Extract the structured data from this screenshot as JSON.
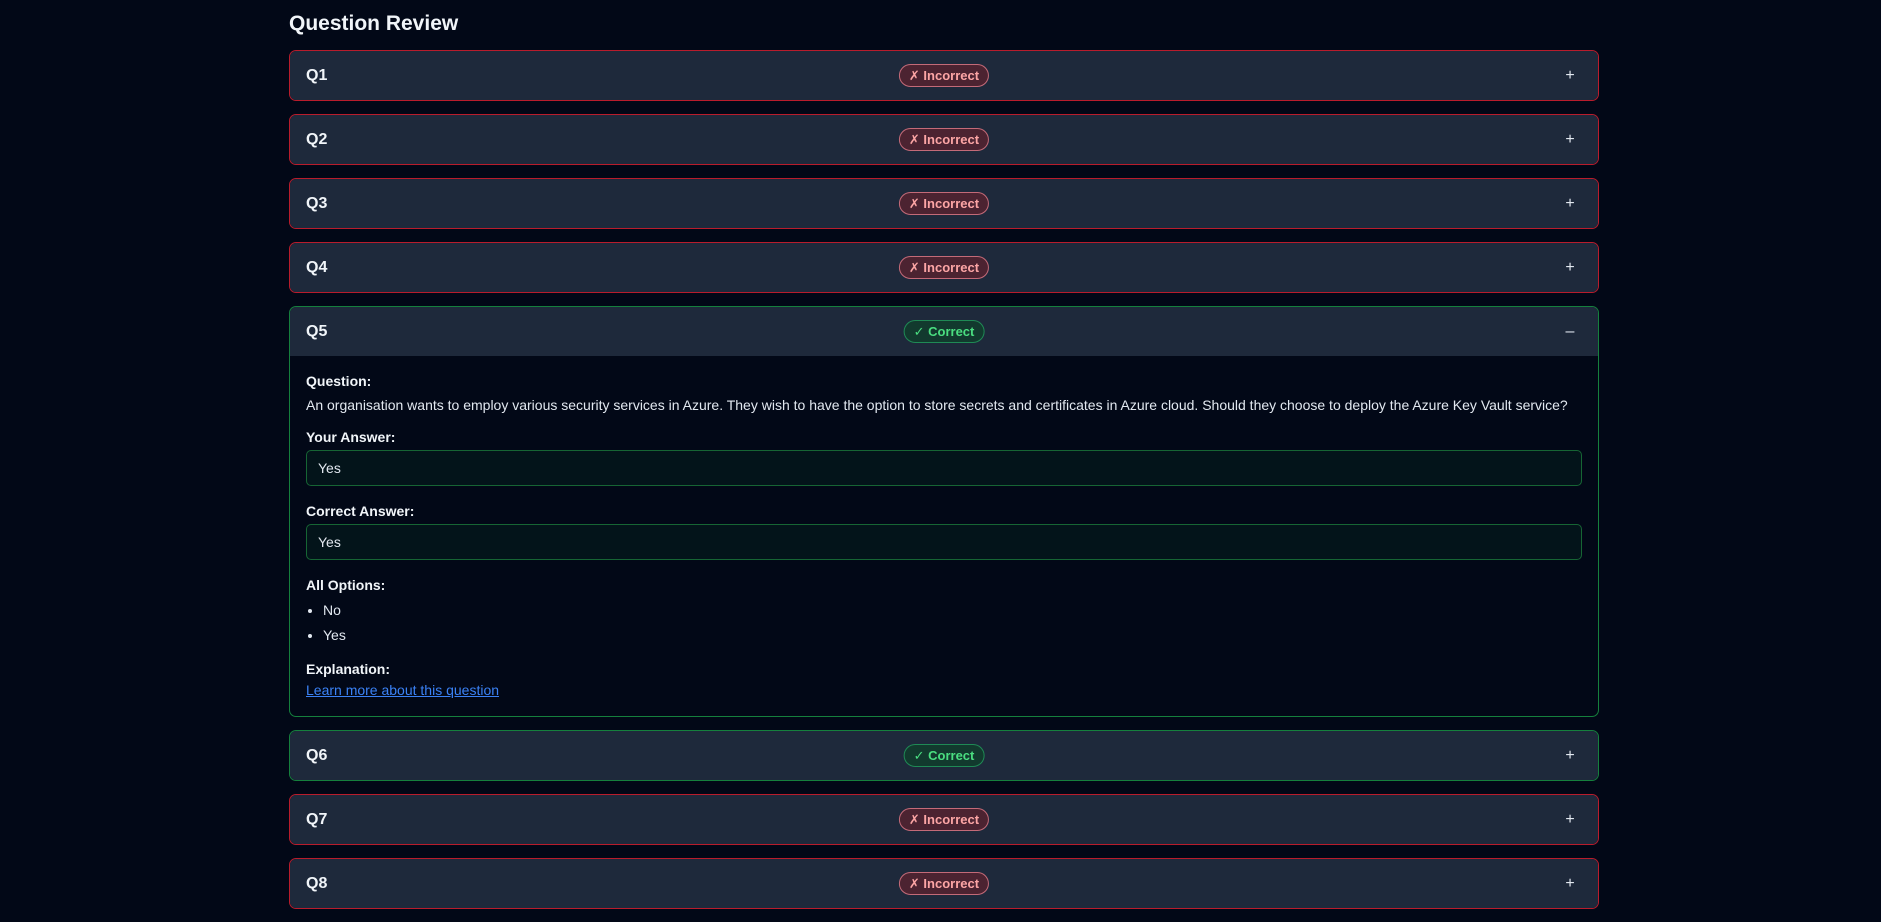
{
  "page_title": "Question Review",
  "status_labels": {
    "incorrect": "✗ Incorrect",
    "correct": "✓ Correct"
  },
  "toggle_icons": {
    "collapsed": "+",
    "expanded": "–"
  },
  "colors": {
    "background": "#020817",
    "card_header": "#1e293b",
    "incorrect_border": "#b91c2c",
    "correct_border": "#15803d",
    "link": "#3b82f6"
  },
  "questions": [
    {
      "label": "Q1",
      "status": "incorrect"
    },
    {
      "label": "Q2",
      "status": "incorrect"
    },
    {
      "label": "Q3",
      "status": "incorrect"
    },
    {
      "label": "Q4",
      "status": "incorrect"
    },
    {
      "label": "Q5",
      "status": "correct",
      "expanded": true,
      "question_label": "Question:",
      "question_text": "An organisation wants to employ various security services in Azure. They wish to have the option to store secrets and certificates in Azure cloud. Should they choose to deploy the Azure Key Vault service?",
      "your_answer_label": "Your Answer:",
      "your_answer": "Yes",
      "correct_answer_label": "Correct Answer:",
      "correct_answer": "Yes",
      "all_options_label": "All Options:",
      "options": [
        "No",
        "Yes"
      ],
      "explanation_label": "Explanation:",
      "learn_more_link": "Learn more about this question"
    },
    {
      "label": "Q6",
      "status": "correct"
    },
    {
      "label": "Q7",
      "status": "incorrect"
    },
    {
      "label": "Q8",
      "status": "incorrect"
    }
  ]
}
